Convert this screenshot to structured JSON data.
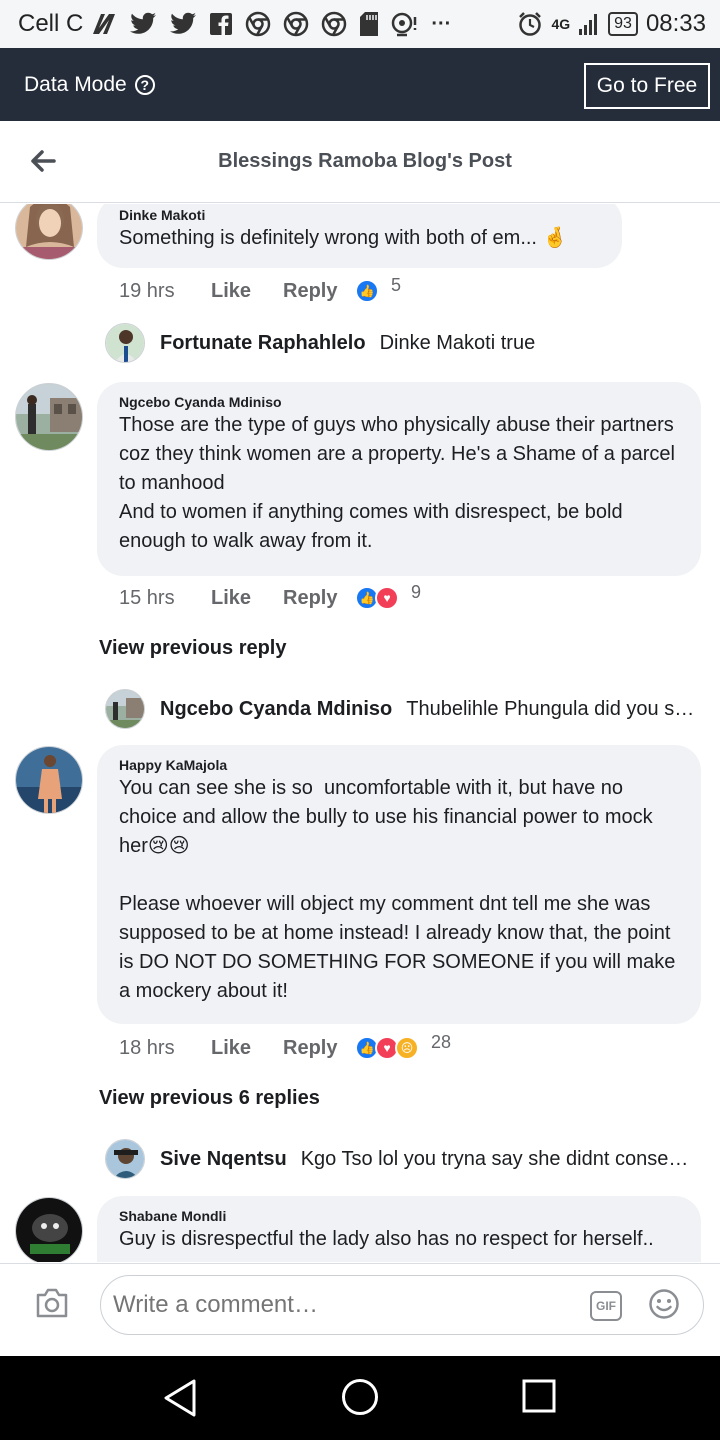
{
  "status_bar": {
    "carrier": "Cell C",
    "network": "4G",
    "battery": "93",
    "time": "08:33",
    "icons": [
      "nfc-icon",
      "twitter-icon",
      "twitter-icon",
      "facebook-icon",
      "chrome-icon",
      "chrome-icon",
      "chrome-icon",
      "sd-card-icon",
      "notification-icon",
      "more-icon",
      "alarm-icon",
      "signal-icon"
    ]
  },
  "data_bar": {
    "label": "Data Mode",
    "help_icon": "?",
    "button": "Go to Free"
  },
  "header": {
    "title": "Blessings Ramoba Blog's Post"
  },
  "comments": [
    {
      "author": "Dinke Makoti",
      "text": "Something is definitely wrong with both of em... 🤞",
      "time": "19 hrs",
      "like": "Like",
      "reply": "Reply",
      "reactions": [
        "like"
      ],
      "count": "5"
    },
    {
      "author": "Ngcebo Cyanda Mdiniso",
      "text": "Those are the type of guys who physically abuse their partners coz they think women are a property. He's a Shame of a parcel to manhood\nAnd to women if anything comes with disrespect, be bold enough to walk away from it.",
      "time": "15 hrs",
      "like": "Like",
      "reply": "Reply",
      "reactions": [
        "like",
        "love"
      ],
      "count": "9"
    },
    {
      "author": "Happy KaMajola",
      "text": "You can see she is so  uncomfortable with it, but have no choice and allow the bully to use his financial power to mock her😢😢\n\nPlease whoever will object my comment dnt tell me she was supposed to be at home instead! I already know that, the point is DO NOT DO SOMETHING FOR SOMEONE if you will make a mockery about it!",
      "time": "18 hrs",
      "like": "Like",
      "reply": "Reply",
      "reactions": [
        "like",
        "love",
        "sad"
      ],
      "count": "28"
    },
    {
      "author": "Shabane Mondli",
      "text": "Guy is disrespectful the lady also has no respect for herself.."
    }
  ],
  "replies": [
    {
      "name": "Fortunate Raphahlelo",
      "text": "Dinke Makoti true"
    },
    {
      "name": "Ngcebo Cyanda Mdiniso",
      "text": "Thubelihle Phungula did you see ..."
    },
    {
      "name": "Sive Nqentsu",
      "text": "Kgo Tso lol you tryna say she didnt consent..."
    }
  ],
  "view_previous": [
    "View previous reply",
    "View previous 6 replies"
  ],
  "composer": {
    "placeholder": "Write a comment…",
    "gif": "GIF"
  },
  "colors": {
    "data_bar": "#252d3b",
    "bubble": "#f0f2f5",
    "like": "#1877f2",
    "love": "#f33e58",
    "sad": "#f7b125"
  }
}
